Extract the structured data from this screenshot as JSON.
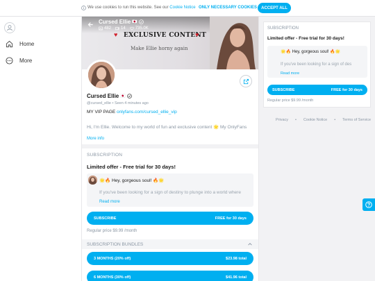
{
  "cookie": {
    "text": "We use cookies to run this website. See our",
    "link": "Cookie Notice",
    "necessary": "ONLY NECESSARY COOKIES",
    "accept": "ACCEPT ALL"
  },
  "nav": {
    "items": [
      {
        "label": "Home",
        "icon": "home-icon"
      },
      {
        "label": "More",
        "icon": "more-icon"
      }
    ]
  },
  "cover": {
    "name": "Cursed Ellie",
    "flag": "🇯🇵",
    "stats": [
      {
        "icon": "image-icon",
        "value": "482"
      },
      {
        "icon": "video-icon",
        "value": "14"
      },
      {
        "icon": "heart-icon",
        "value": "735.0K"
      }
    ],
    "headline": "EXCLUSIVE CONTENT",
    "tagline": "Make Ellie horny again"
  },
  "profile": {
    "name": "Cursed Ellie",
    "flag": "🇯🇵",
    "handle": "@cursed_ellie",
    "seen": "Seen 4 minutes ago",
    "vip_label": "MY VIP PAGE",
    "vip_link": "onlyfans.com/cursed_ellie_vip",
    "bio": "Hi, I'm Ellie. Welcome to my world of fun and exclusive content 🌟 My OnlyFans",
    "more_info": "More info"
  },
  "subscription": {
    "title": "SUBSCRIPTION",
    "offer": "Limited offer - Free trial for 30 days!",
    "greeting": "🌟🔥 Hey, gorgeous soul! 🔥🌟",
    "message": "If you've been looking for a sign of destiny to plunge into a world where",
    "read_more": "Read more",
    "subscribe_label": "SUBSCRIBE",
    "subscribe_price": "FREE for 30 days",
    "regular_price": "Regular price $9.99 /month"
  },
  "bundles": {
    "title": "SUBSCRIPTION BUNDLES",
    "items": [
      {
        "label": "3 MONTHS (20% off)",
        "price": "$23.98 total"
      },
      {
        "label": "6 MONTHS (30% off)",
        "price": "$41.96 total"
      }
    ]
  },
  "sidebar": {
    "title": "SUBSCRIPTION",
    "offer": "Limited offer - Free trial for 30 days!",
    "greeting": "🌟🔥 Hey, gorgeous soul! 🔥🌟",
    "message": "If you've been looking for a sign of des",
    "read_more": "Read more",
    "subscribe_label": "SUBSCRIBE",
    "subscribe_price": "FREE for 30 days",
    "regular_price": "Regular price $9.99 /month"
  },
  "footer": {
    "links": [
      "Privacy",
      "Cookie Notice",
      "Terms of Service"
    ]
  },
  "colors": {
    "accent": "#00aff0",
    "heart": "#d1202c",
    "muted": "#8a96a3"
  }
}
